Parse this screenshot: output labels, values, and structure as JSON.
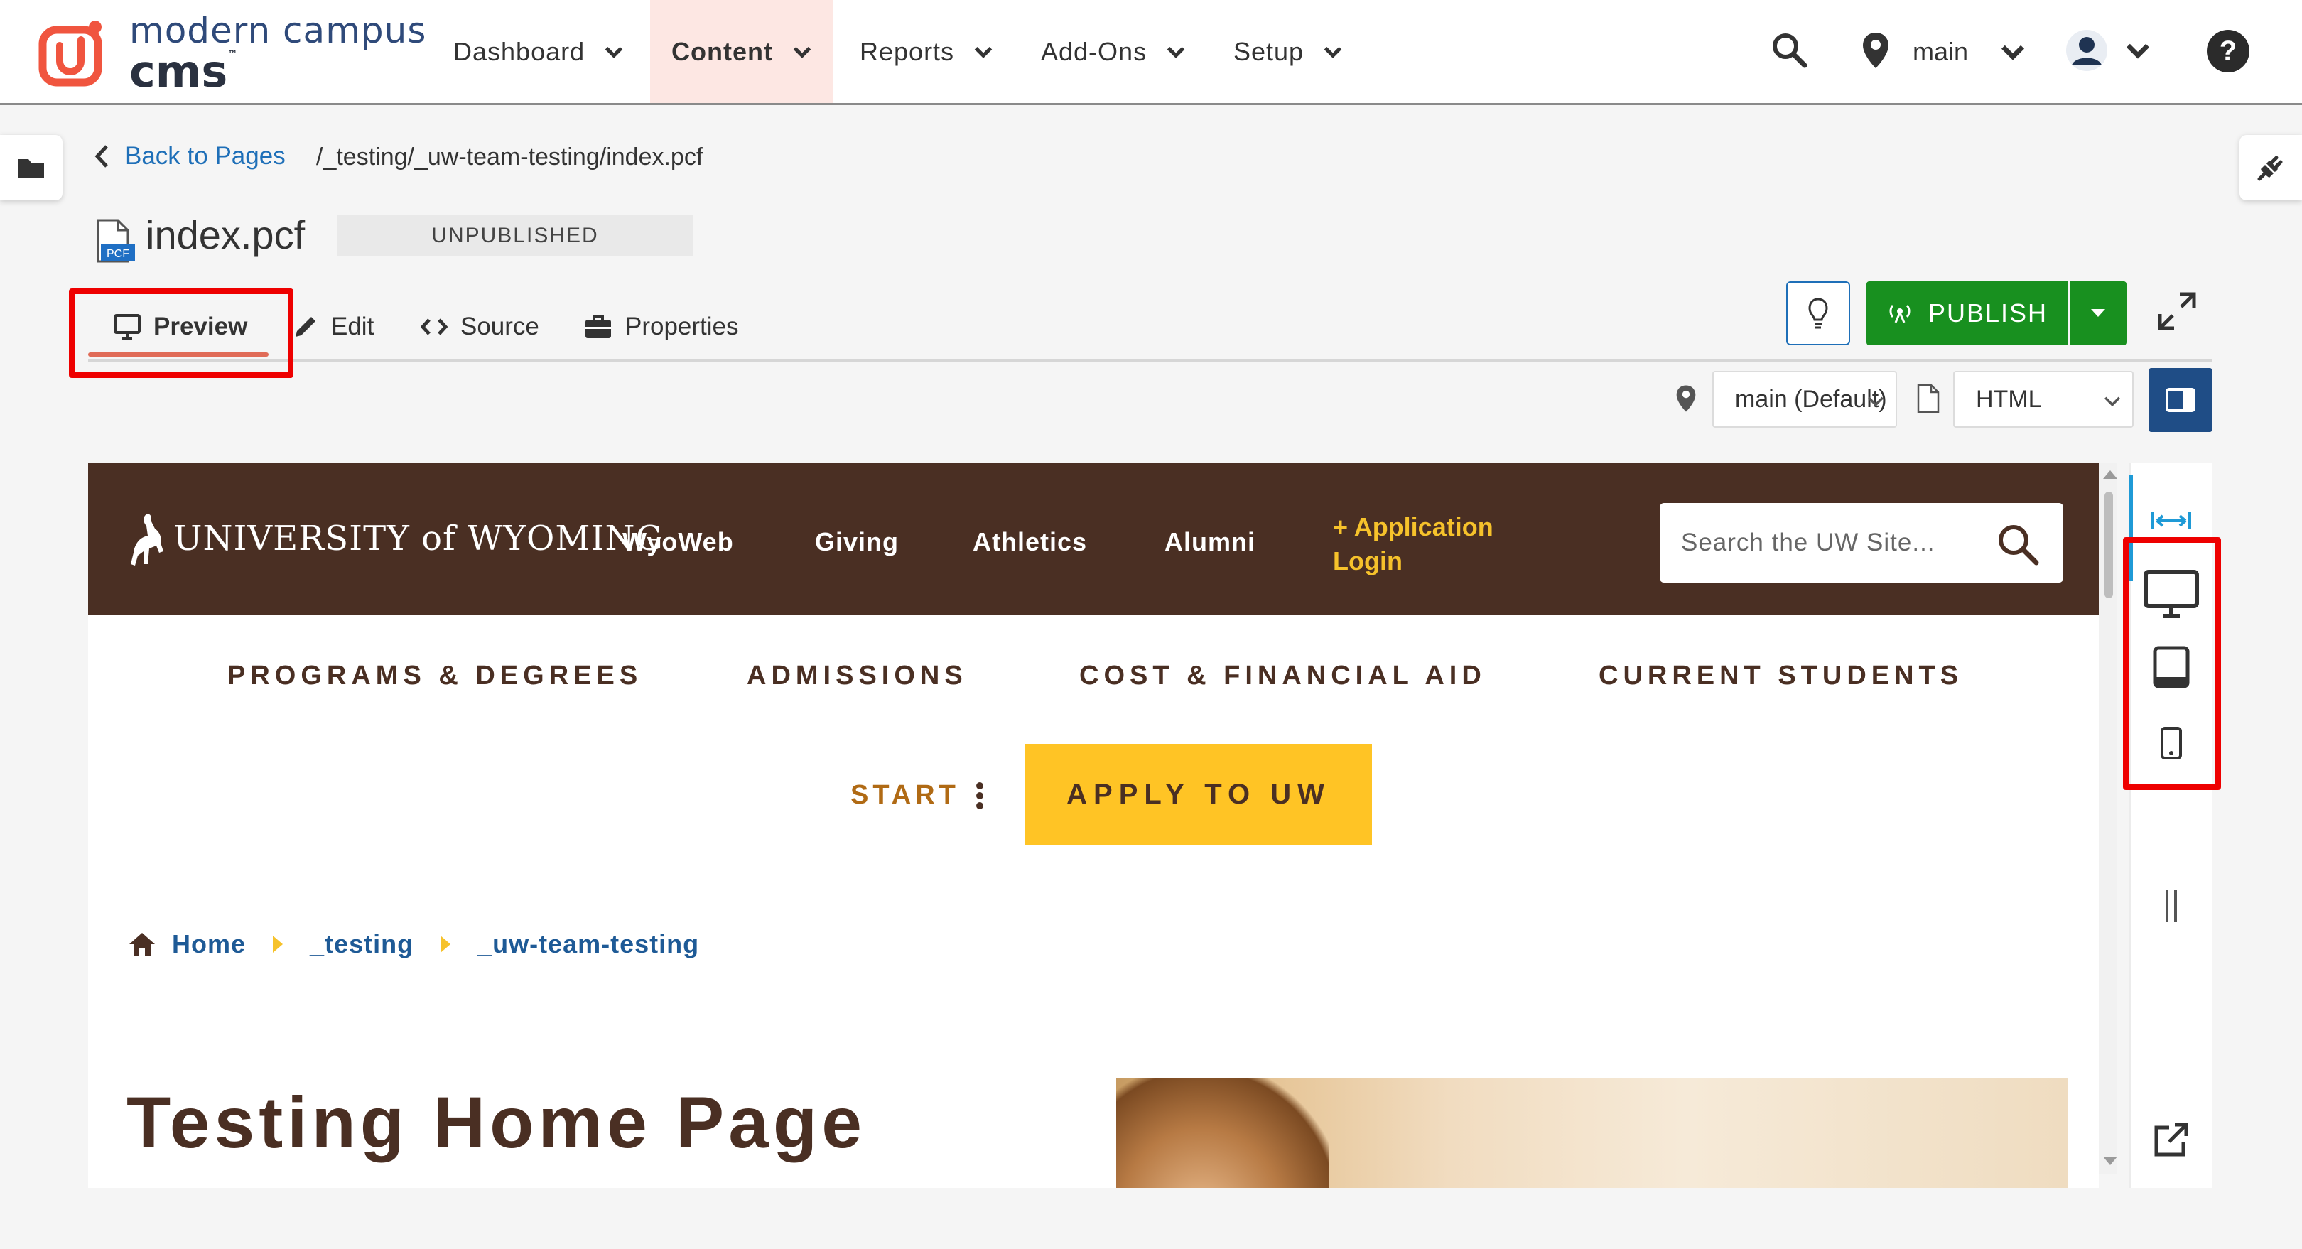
{
  "app": {
    "logo": {
      "line1": "modern campus",
      "line2": "cms",
      "tm": "™"
    },
    "nav": [
      {
        "label": "Dashboard"
      },
      {
        "label": "Content"
      },
      {
        "label": "Reports"
      },
      {
        "label": "Add-Ons"
      },
      {
        "label": "Setup"
      }
    ],
    "branch": "main"
  },
  "page": {
    "back_label": "Back to Pages",
    "path": "/_testing/_uw-team-testing/index.pcf",
    "file_badge": "PCF",
    "file_name": "index.pcf",
    "status": "UNPUBLISHED"
  },
  "view_tabs": [
    {
      "label": "Preview"
    },
    {
      "label": "Edit"
    },
    {
      "label": "Source"
    },
    {
      "label": "Properties"
    }
  ],
  "actions": {
    "publish_label": "PUBLISH"
  },
  "toolbar": {
    "branch_select": "main (Default)",
    "format_select": "HTML"
  },
  "preview": {
    "uw": {
      "wordmark": "UNIVERSITY of WYOMING",
      "top_links": [
        "WyoWeb",
        "Giving",
        "Athletics",
        "Alumni"
      ],
      "application_link": "+ Application Login",
      "search_placeholder": "Search the UW Site...",
      "main_nav": [
        "PROGRAMS & DEGREES",
        "ADMISSIONS",
        "COST & FINANCIAL AID",
        "CURRENT STUDENTS"
      ],
      "start_label": "START",
      "apply_label": "APPLY TO UW",
      "breadcrumbs": [
        "Home",
        "_testing",
        "_uw-team-testing"
      ],
      "heading": "Testing Home Page"
    }
  },
  "colors": {
    "accent": "#e06b57",
    "publish": "#18901f",
    "uw_brown": "#4a2f23",
    "uw_gold": "#ffc425",
    "highlight": "#ee0000"
  }
}
